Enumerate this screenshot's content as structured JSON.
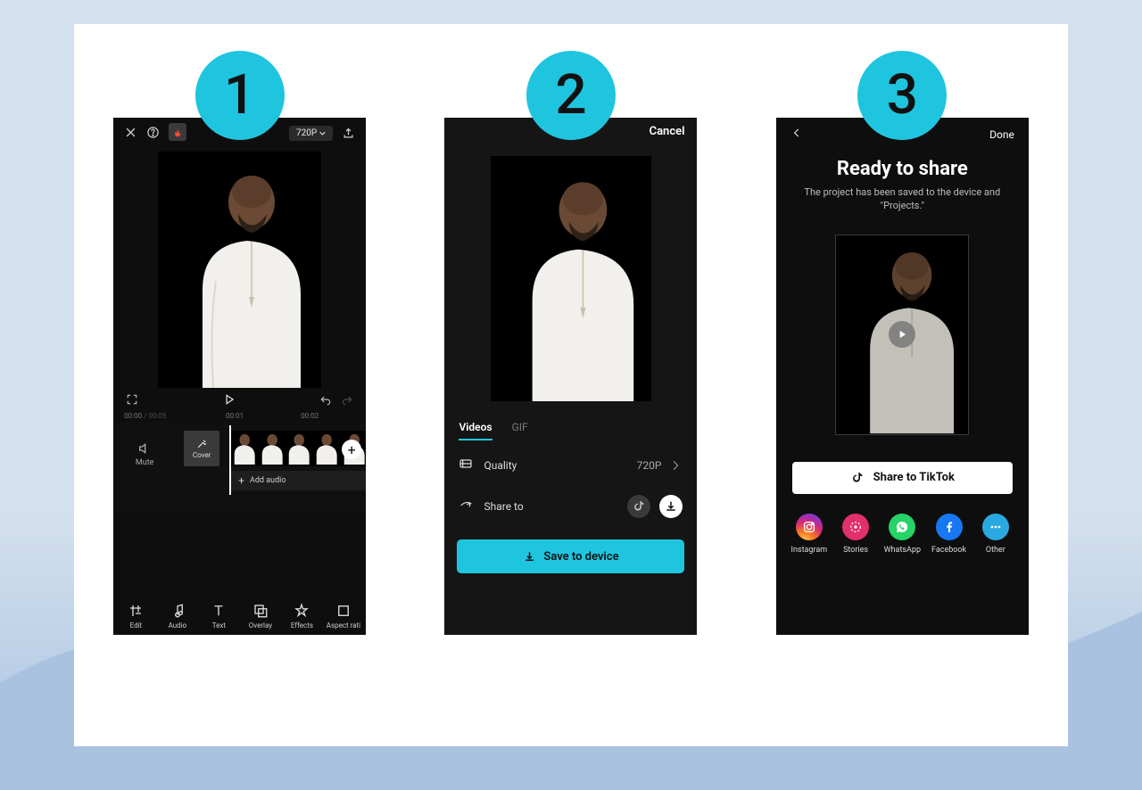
{
  "steps": [
    "1",
    "2",
    "3"
  ],
  "screen1": {
    "resolution_chip": "720P",
    "time_current": "00:00",
    "time_total": "00:05",
    "marks": {
      "m1": "00:00",
      "m2": "00:01",
      "m3": "00:02"
    },
    "mute": "Mute",
    "cover": "Cover",
    "add_audio": "Add audio",
    "tools": {
      "edit": "Edit",
      "audio": "Audio",
      "text": "Text",
      "overlay": "Overlay",
      "effects": "Effects",
      "aspect": "Aspect rati"
    }
  },
  "screen2": {
    "cancel": "Cancel",
    "tab_videos": "Videos",
    "tab_gif": "GIF",
    "quality_label": "Quality",
    "quality_value": "720P",
    "share_label": "Share to",
    "save_btn": "Save to device"
  },
  "screen3": {
    "done": "Done",
    "title": "Ready to share",
    "subtitle": "The project has been saved to the device and \"Projects.\"",
    "share_tiktok": "Share to TikTok",
    "targets": {
      "instagram": "Instagram",
      "stories": "Stories",
      "whatsapp": "WhatsApp",
      "facebook": "Facebook",
      "other": "Other"
    }
  }
}
